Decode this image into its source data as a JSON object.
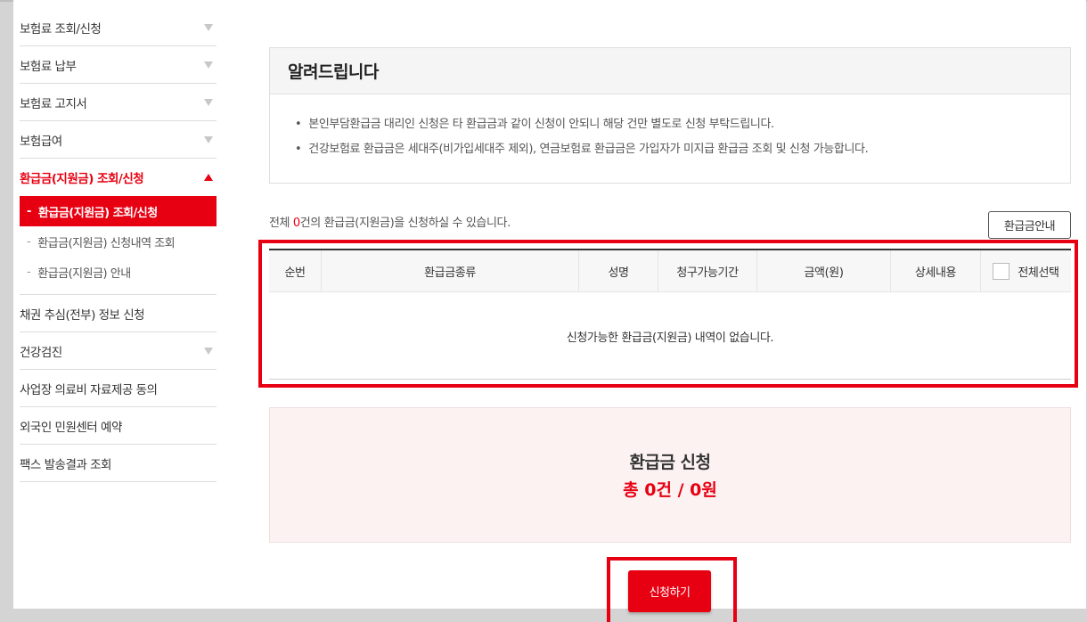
{
  "sidebar": {
    "items": [
      {
        "label": "보험료 조회/신청"
      },
      {
        "label": "보험료 납부"
      },
      {
        "label": "보험료 고지서"
      },
      {
        "label": "보험급여"
      },
      {
        "label": "환급금(지원금) 조회/신청"
      },
      {
        "label": "채권 추심(전부) 정보 신청"
      },
      {
        "label": "건강검진"
      },
      {
        "label": "사업장 의료비 자료제공 동의"
      },
      {
        "label": "외국인 민원센터 예약"
      },
      {
        "label": "팩스 발송결과 조회"
      }
    ],
    "submenu": [
      {
        "label": "환급금(지원금) 조회/신청"
      },
      {
        "label": "환급금(지원금) 신청내역 조회"
      },
      {
        "label": "환급금(지원금) 안내"
      }
    ],
    "dash": "-"
  },
  "notice": {
    "title": "알려드립니다",
    "bullet": "•",
    "lines": [
      "본인부담환급금 대리인 신청은 타 환급금과 같이 신청이 안되니 해당 건만 별도로 신청 부탁드립니다.",
      "건강보험료 환급금은 세대주(비가입세대주 제외), 연금보험료 환급금은 가입자가 미지급 환급금 조회 및 신청 가능합니다."
    ]
  },
  "summary": {
    "prefix": "전체 ",
    "count": "0",
    "suffix": "건의 환급금(지원금)을 신청하실 수 있습니다."
  },
  "guide_button": "환급금안내",
  "table": {
    "headers": [
      "순번",
      "환급금종류",
      "성명",
      "청구가능기간",
      "금액(원)",
      "상세내용",
      "전체선택"
    ],
    "empty_message": "신청가능한 환급금(지원금) 내역이 없습니다."
  },
  "refund": {
    "title": "환급금 신청",
    "total": "총 0건 / 0원"
  },
  "apply_button": "신청하기",
  "colors": {
    "accent": "#e60012",
    "refund_bg": "#fdf2f2"
  }
}
